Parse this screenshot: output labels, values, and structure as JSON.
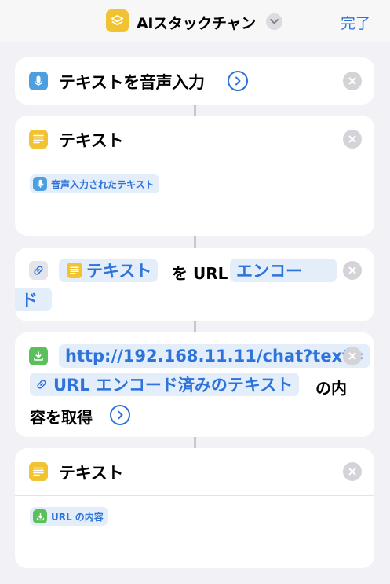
{
  "header": {
    "title": "AIスタックチャン",
    "done_label": "完了"
  },
  "actions": {
    "dictate": {
      "title": "テキストを音声入力"
    },
    "text1": {
      "title": "テキスト",
      "variable": "音声入力されたテキスト"
    },
    "urlencode": {
      "variable": "テキスト",
      "middle": "を URL",
      "mode_part1": "エンコー",
      "mode_part2": "ド"
    },
    "getcontents": {
      "url": "http://192.168.11.11/chat?text=",
      "variable": "URL エンコード済みのテキスト",
      "suffix1": "の内",
      "suffix2": "容を取得"
    },
    "text2": {
      "title": "テキスト",
      "variable": "URL の内容"
    }
  },
  "colors": {
    "accent": "#2d73d9",
    "chip_bg": "#e4eefb",
    "dictation_icon": "#4d9fe0",
    "text_icon": "#f1c232",
    "download_icon": "#5ac05a"
  }
}
